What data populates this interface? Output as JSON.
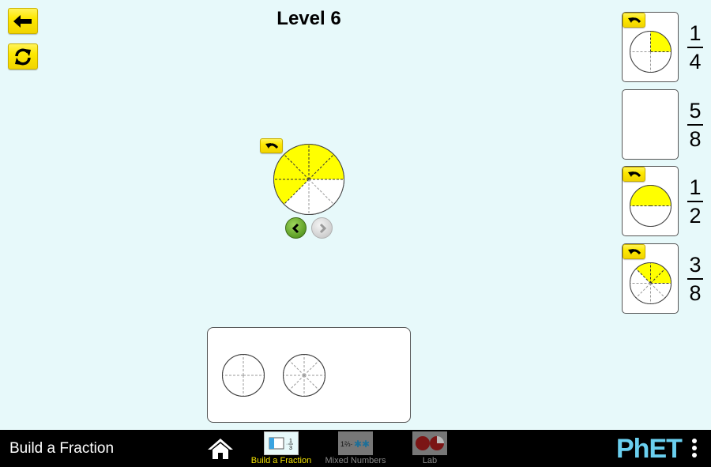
{
  "header": {
    "title": "Level 6"
  },
  "buttons": {
    "back": "back-arrow-icon",
    "refresh": "refresh-icon",
    "undo": "undo-icon"
  },
  "builder": {
    "current_fraction": {
      "numerator": 5,
      "denominator": 8
    },
    "fill_color": "#ffff00",
    "prev_enabled": true,
    "next_enabled": false
  },
  "targets": [
    {
      "fraction": {
        "numerator": "1",
        "denominator": "4"
      },
      "filled": true,
      "pie": {
        "denominator": 4,
        "filled_slices": [
          0
        ]
      }
    },
    {
      "fraction": {
        "numerator": "5",
        "denominator": "8"
      },
      "filled": false
    },
    {
      "fraction": {
        "numerator": "1",
        "denominator": "2"
      },
      "filled": true,
      "pie": {
        "denominator": 2,
        "filled_slices": [
          0
        ]
      }
    },
    {
      "fraction": {
        "numerator": "3",
        "denominator": "8"
      },
      "filled": true,
      "pie": {
        "denominator": 8,
        "filled_slices": [
          0,
          1,
          2
        ]
      }
    }
  ],
  "pieces_box": {
    "containers": [
      {
        "denominator": 4
      },
      {
        "denominator": 8
      }
    ]
  },
  "navbar": {
    "sim_title": "Build a Fraction",
    "screens": [
      {
        "label": "Build a Fraction",
        "active": true
      },
      {
        "label": "Mixed Numbers",
        "active": false
      },
      {
        "label": "Lab",
        "active": false
      }
    ],
    "brand": "PhET"
  },
  "colors": {
    "background": "#e7f9fa",
    "button_yellow": "#fde800",
    "pie_fill": "#ffff00",
    "navbar": "#000000",
    "active_tab": "#f2e200",
    "phet_blue": "#6acfef"
  }
}
